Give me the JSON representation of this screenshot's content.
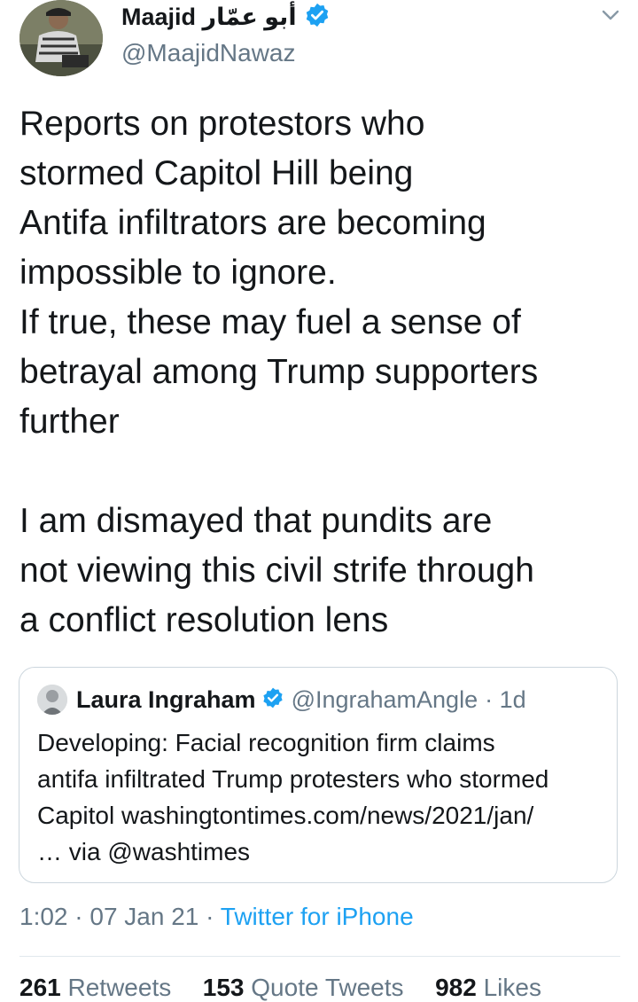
{
  "author": {
    "display_name": "Maajid أبو عمّار",
    "handle": "@MaajidNawaz",
    "avatar_icon": "avatar-photo",
    "verified_icon": "verified-badge-icon"
  },
  "menu_icon": "chevron-down-icon",
  "tweet": {
    "text": "Reports on protestors who\nstormed Capitol Hill being\nAntifa infiltrators are becoming\nimpossible to ignore.\nIf true, these may fuel a sense of\nbetrayal among Trump supporters\nfurther\n\nI am dismayed that pundits are\nnot viewing this civil strife through\na conflict resolution lens"
  },
  "quoted_tweet": {
    "display_name": "Laura Ingraham",
    "handle": "@IngrahamAngle",
    "age": "· 1d",
    "text": "Developing: Facial recognition firm claims\nantifa infiltrated Trump protesters who stormed\nCapitol washingtontimes.com/news/2021/jan/\n… via @washtimes"
  },
  "meta": {
    "time": "1:02",
    "date": "· 07 Jan 21 ·",
    "source": "Twitter for iPhone"
  },
  "stats": {
    "retweets_count": "261",
    "retweets_label": "Retweets",
    "quotes_count": "153",
    "quotes_label": "Quote Tweets",
    "likes_count": "982",
    "likes_label": "Likes"
  },
  "colors": {
    "accent": "#1da1f2",
    "secondary_text": "#657786",
    "border": "#ccd6dd"
  }
}
